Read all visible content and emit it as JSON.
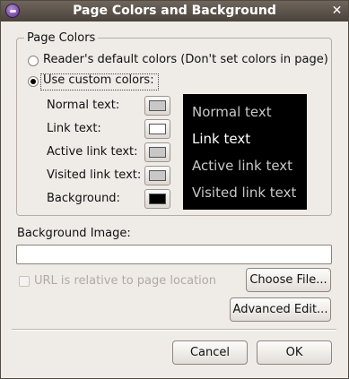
{
  "window": {
    "title": "Page Colors and Background",
    "close_glyph": "✕",
    "app_icon": "app-icon"
  },
  "page_colors": {
    "group_label": "Page Colors",
    "radio_default": {
      "label": "Reader's default colors (Don't set colors in page)",
      "selected": false
    },
    "radio_custom": {
      "label": "Use custom colors:",
      "selected": true
    },
    "rows": [
      {
        "label": "Normal text:",
        "swatch_color": "#c8c8c8"
      },
      {
        "label": "Link text:",
        "swatch_color": "#ffffff"
      },
      {
        "label": "Active link text:",
        "swatch_color": "#c8c8c8"
      },
      {
        "label": "Visited link text:",
        "swatch_color": "#c8c8c8"
      },
      {
        "label": "Background:",
        "swatch_color": "#000000"
      }
    ],
    "preview": {
      "background_color": "#000000",
      "normal_text": "Normal text",
      "link_text": "Link text",
      "active_link_text": "Active link text",
      "visited_link_text": "Visited link text"
    }
  },
  "background_image": {
    "label": "Background Image:",
    "value": "",
    "relative_checkbox_label": "URL is relative to page location",
    "relative_checked": false,
    "choose_file_label": "Choose File...",
    "advanced_edit_label": "Advanced Edit..."
  },
  "footer": {
    "cancel_label": "Cancel",
    "ok_label": "OK"
  },
  "colors": {
    "titlebar": "#574f47",
    "dialog_bg": "#efebe7",
    "preview_normal": "#c8c8c8",
    "preview_link": "#ffffff"
  }
}
